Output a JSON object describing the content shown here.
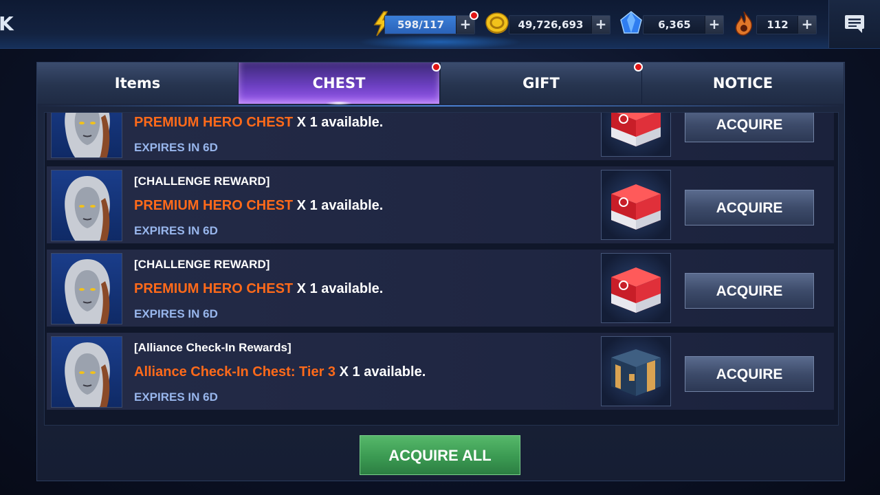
{
  "topbar": {
    "back_mark": "K",
    "energy": {
      "value": "598/117",
      "icon": "lightning-icon",
      "color": "#f5c518"
    },
    "gold": {
      "value": "49,726,693",
      "icon": "gold-coin-icon",
      "color": "#e8b81a"
    },
    "crystal": {
      "value": "6,365",
      "icon": "crystal-icon",
      "color": "#2f7df0"
    },
    "fire": {
      "value": "112",
      "icon": "fire-icon",
      "color": "#e0772a"
    },
    "plus_label": "+",
    "chat_icon": "chat-icon"
  },
  "tabs": [
    {
      "label": "Items",
      "active": false,
      "badge": false
    },
    {
      "label": "CHEST",
      "active": true,
      "badge": true
    },
    {
      "label": "GIFT",
      "active": false,
      "badge": true
    },
    {
      "label": "NOTICE",
      "active": false,
      "badge": false
    }
  ],
  "rows": [
    {
      "label": "",
      "item": "PREMIUM HERO CHEST",
      "qty": " X 1 available.",
      "expires": "EXPIRES IN 6D",
      "chest": "red-chest-icon",
      "button": "ACQUIRE"
    },
    {
      "label": "[CHALLENGE REWARD]",
      "item": "PREMIUM HERO CHEST",
      "qty": " X 1 available.",
      "expires": "EXPIRES IN 6D",
      "chest": "red-chest-icon",
      "button": "ACQUIRE"
    },
    {
      "label": "[CHALLENGE REWARD]",
      "item": "PREMIUM HERO CHEST",
      "qty": " X 1 available.",
      "expires": "EXPIRES IN 6D",
      "chest": "red-chest-icon",
      "button": "ACQUIRE"
    },
    {
      "label": "[Alliance Check-In Rewards]",
      "item": "Alliance Check-In Chest: Tier 3",
      "qty": " X 1 available.",
      "expires": "EXPIRES IN 6D",
      "chest": "alliance-chest-icon",
      "button": "ACQUIRE"
    }
  ],
  "acquire_all": "ACQUIRE ALL",
  "colors": {
    "item_highlight": "#ff6a1a",
    "expires": "#98b6ec",
    "active_tab": "#7a48d8",
    "acquire_all": "#3b9a52"
  }
}
